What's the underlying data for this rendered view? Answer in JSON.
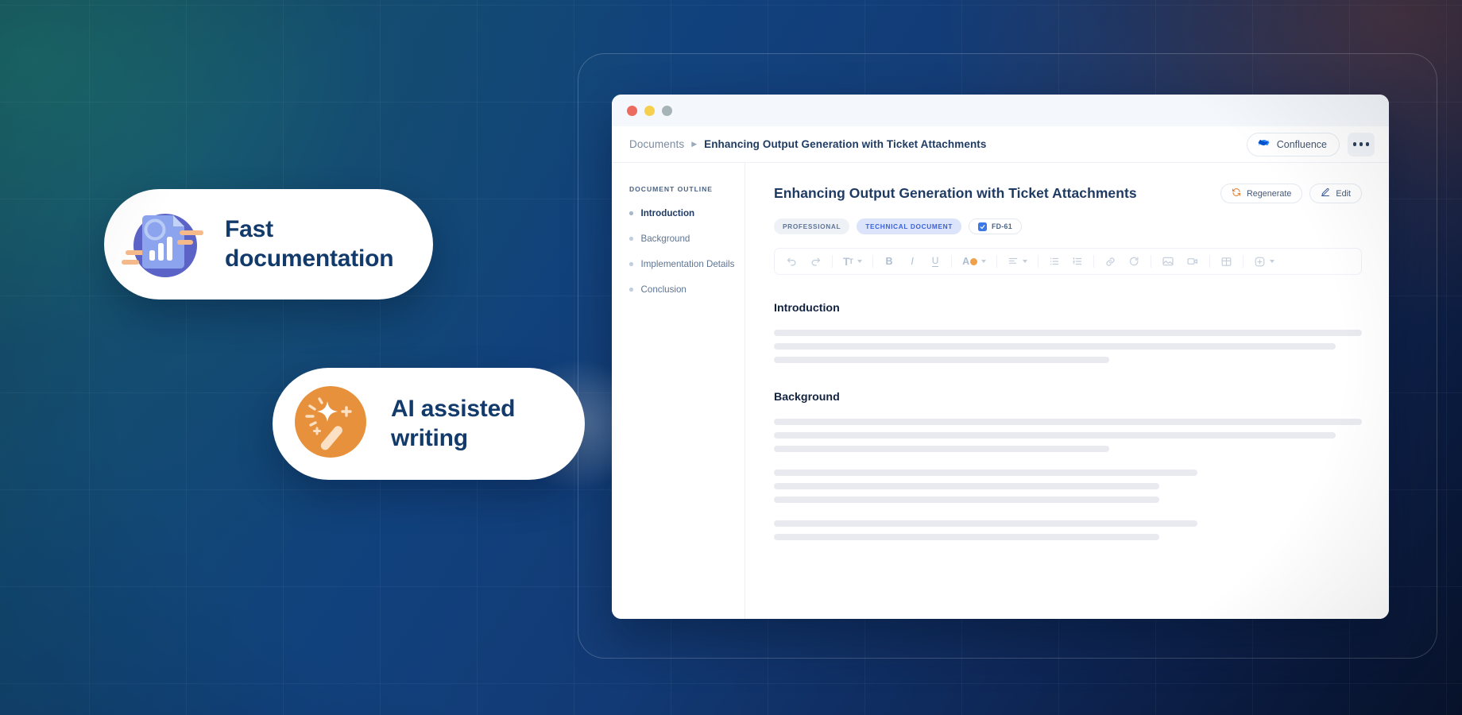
{
  "window": {
    "traffic_lights": [
      "close",
      "minimize",
      "maximize"
    ],
    "breadcrumb": {
      "root": "Documents",
      "separator": "▶",
      "current": "Enhancing Output Generation with Ticket Attachments"
    },
    "integration_button": {
      "label": "Confluence",
      "icon": "confluence-logo-icon"
    },
    "more_button": {
      "icon": "ellipsis-icon"
    }
  },
  "sidebar": {
    "label": "DOCUMENT OUTLINE",
    "items": [
      {
        "label": "Introduction",
        "active": true
      },
      {
        "label": "Background",
        "active": false
      },
      {
        "label": "Implementation Details",
        "active": false
      },
      {
        "label": "Conclusion",
        "active": false
      }
    ]
  },
  "document": {
    "title": "Enhancing Output Generation with Ticket Attachments",
    "actions": [
      {
        "label": "Regenerate",
        "icon": "refresh-icon",
        "icon_color": "#e8833a"
      },
      {
        "label": "Edit",
        "icon": "pencil-icon",
        "icon_color": "#2f5fa8"
      }
    ],
    "tags": [
      {
        "label": "PROFESSIONAL",
        "style": "grey"
      },
      {
        "label": "TECHNICAL DOCUMENT",
        "style": "blue"
      },
      {
        "label": "FD-61",
        "style": "ticket",
        "icon": "checkbox-checked-icon"
      }
    ],
    "toolbar": [
      {
        "name": "undo",
        "glyph": "↶"
      },
      {
        "name": "redo",
        "glyph": "↷"
      },
      {
        "name": "separator"
      },
      {
        "name": "text-size",
        "glyph": "Tᴛ",
        "caret": true
      },
      {
        "name": "separator"
      },
      {
        "name": "bold",
        "glyph": "B"
      },
      {
        "name": "italic",
        "glyph": "I"
      },
      {
        "name": "underline",
        "glyph": "U"
      },
      {
        "name": "separator"
      },
      {
        "name": "text-color",
        "glyph": "A",
        "swatch": "#f0a04b",
        "caret": true
      },
      {
        "name": "separator"
      },
      {
        "name": "align",
        "glyph": "align",
        "caret": true
      },
      {
        "name": "separator"
      },
      {
        "name": "bullet-list",
        "glyph": "bullets"
      },
      {
        "name": "numbered-list",
        "glyph": "numbers"
      },
      {
        "name": "separator"
      },
      {
        "name": "link",
        "glyph": "link"
      },
      {
        "name": "sync",
        "glyph": "sync"
      },
      {
        "name": "separator"
      },
      {
        "name": "image",
        "glyph": "image"
      },
      {
        "name": "video",
        "glyph": "video"
      },
      {
        "name": "separator"
      },
      {
        "name": "table",
        "glyph": "table"
      },
      {
        "name": "separator"
      },
      {
        "name": "add",
        "glyph": "plus-circle",
        "caret": true
      }
    ],
    "sections": [
      {
        "heading": "Introduction",
        "blocks": [
          {
            "lines": [
              100,
              96,
              57
            ]
          }
        ]
      },
      {
        "heading": "Background",
        "blocks": [
          {
            "lines": [
              100,
              96,
              57
            ]
          },
          {
            "lines": [
              72,
              65,
              65
            ]
          },
          {
            "lines": [
              72,
              65
            ]
          }
        ]
      }
    ]
  },
  "features": [
    {
      "id": "fast-documentation",
      "title": "Fast\ndocumentation",
      "line1": "Fast",
      "line2": "documentation",
      "icon": "document-chart-icon",
      "circle_color": "#5b63c7",
      "accent_color": "#f5b98a"
    },
    {
      "id": "ai-assisted-writing",
      "title": "AI assisted\nwriting",
      "line1": "AI assisted",
      "line2": "writing",
      "icon": "magic-wand-icon",
      "circle_color": "#e8913c",
      "accent_color": "#fbe0c4"
    }
  ],
  "theme": {
    "background_from": "#19545e",
    "background_to": "#081430",
    "brand_blue": "#123a6b",
    "accent_orange": "#e8833a",
    "tag_blue": "#3a63d8"
  }
}
